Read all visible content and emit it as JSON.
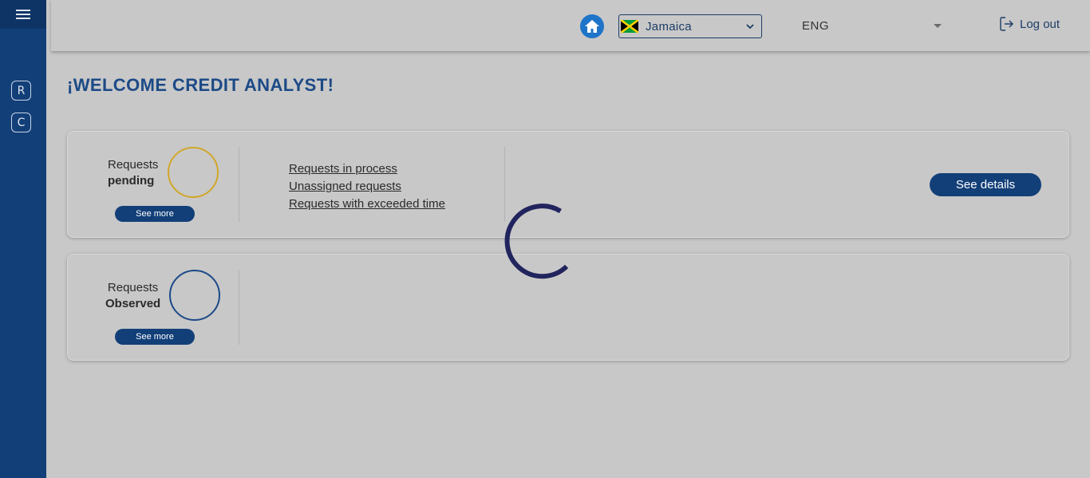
{
  "sidebar": {
    "menu_icon": "hamburger-icon",
    "items": [
      {
        "label": "R"
      },
      {
        "label": "C"
      }
    ]
  },
  "header": {
    "home_icon": "home-icon",
    "country": {
      "label": "Jamaica",
      "flag_icon": "jamaica-flag-icon"
    },
    "language": {
      "label": "ENG"
    },
    "logout": {
      "label": "Log out",
      "icon": "logout-icon"
    }
  },
  "main": {
    "welcome": "¡WELCOME CREDIT ANALYST!",
    "pending_card": {
      "title_line1": "Requests",
      "title_line2": "pending",
      "see_more_label": "See more",
      "links": [
        "Requests in process",
        "Unassigned requests",
        "Requests with exceeded time"
      ],
      "see_details_label": "See details"
    },
    "observed_card": {
      "title_line1": "Requests",
      "title_line2": "Observed",
      "see_more_label": "See more"
    }
  },
  "colors": {
    "sidebar": "#123f78",
    "primary_button": "#123f78",
    "pending_ring": "#d1a62a",
    "observed_ring": "#1c4a86",
    "spinner": "#22245e",
    "home_button": "#1e74c8"
  }
}
